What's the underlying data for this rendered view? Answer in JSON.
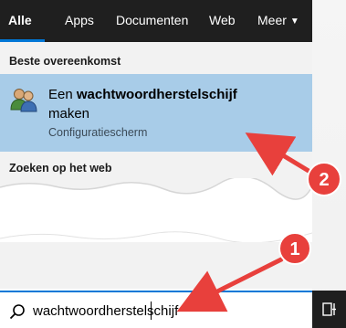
{
  "tabs": [
    {
      "label": "Alle",
      "active": true
    },
    {
      "label": "Apps"
    },
    {
      "label": "Documenten"
    },
    {
      "label": "Web"
    },
    {
      "label": "Meer"
    }
  ],
  "best_match": {
    "header": "Beste overeenkomst",
    "title_prefix": "Een ",
    "title_bold": "wachtwoordherstelschijf",
    "title_line2": "maken",
    "subtitle": "Configuratiescherm",
    "icon": "users-icon"
  },
  "web_section": {
    "header": "Zoeken op het web"
  },
  "search": {
    "value": "wachtwoordherstelschijf",
    "icon": "search-icon"
  },
  "annotations": [
    {
      "number": "1"
    },
    {
      "number": "2"
    }
  ],
  "colors": {
    "accent": "#0078d7",
    "highlight": "#a8cce8",
    "annotation_red": "#e8403c",
    "dark_bar": "#1f1f1f"
  }
}
